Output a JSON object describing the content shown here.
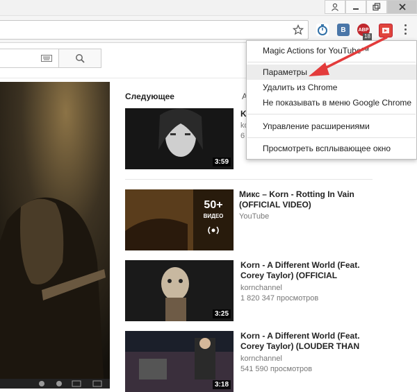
{
  "toolbar": {
    "extensions": [
      {
        "name": "stopwatch-extension",
        "label": ""
      },
      {
        "name": "vk-extension",
        "label": "B"
      },
      {
        "name": "adblock-extension",
        "label": "ABP",
        "badge": "18"
      },
      {
        "name": "magic-actions-extension",
        "label": ""
      }
    ]
  },
  "menu": {
    "header": "Magic Actions for YouTube™",
    "items": [
      "Параметры",
      "Удалить из Chrome",
      "Не показывать в меню Google Chrome",
      "Управление расширениями",
      "Просмотреть всплывающее окно"
    ]
  },
  "sidebar": {
    "up_next": "Следующее",
    "autoplay_partial": "А",
    "first_partial": {
      "title": "K",
      "sub1": "ko",
      "sub2": "6",
      "duration": "3:59"
    },
    "videos": [
      {
        "title": "Микс – Korn - Rotting In Vain (OFFICIAL VIDEO)",
        "channel": "YouTube",
        "mix_count": "50+",
        "mix_label": "ВИДЕО"
      },
      {
        "title": "Korn - A Different World (Feat. Corey Taylor) (OFFICIAL",
        "channel": "kornchannel",
        "views": "1 820 347 просмотров",
        "duration": "3:25"
      },
      {
        "title": "Korn - A Different World (Feat. Corey Taylor) (LOUDER THAN",
        "channel": "kornchannel",
        "views": "541 590 просмотров",
        "duration": "3:18"
      }
    ]
  },
  "colors": {
    "annotation_arrow": "#e33b3b",
    "menu_highlight": "#ececec"
  }
}
